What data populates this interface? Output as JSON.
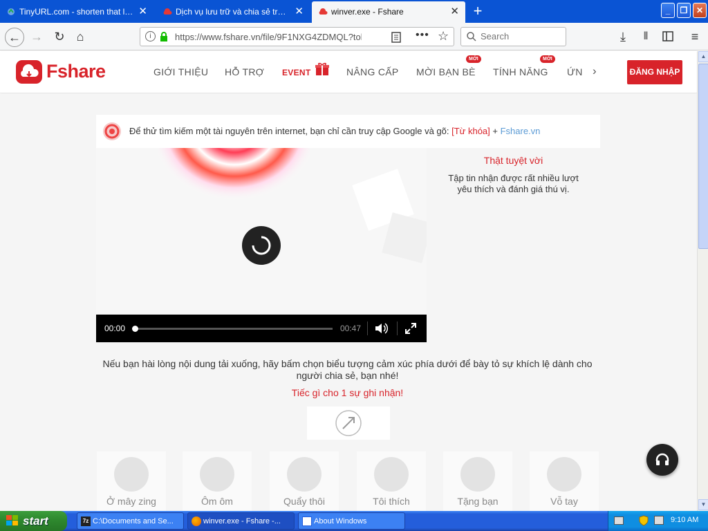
{
  "browser": {
    "tabs": [
      {
        "label": "TinyURL.com - shorten that long U",
        "active": false
      },
      {
        "label": "Dịch vụ lưu trữ và chia sẻ trực tuy",
        "active": false
      },
      {
        "label": "winver.exe - Fshare",
        "active": true
      }
    ],
    "url": "https://www.fshare.vn/file/9F1NXG4ZDMQL?tok",
    "search_placeholder": "Search"
  },
  "site": {
    "logo": "Fshare",
    "menu": [
      "GIỚI THIỆU",
      "HỖ TRỢ",
      "EVENT",
      "NÂNG CẤP",
      "MỜI BẠN BÈ",
      "TÍNH NĂNG",
      "ỨN"
    ],
    "new_badge": "MỚI",
    "login": "ĐĂNG NHẬP"
  },
  "content": {
    "tip_main": "Để thử tìm kiếm một tài nguyên trên internet, bạn chỉ cần truy cập Google và gõ: ",
    "tip_keyword": "[Từ khóa]",
    "tip_plus": " + ",
    "tip_site": "Fshare.vn",
    "video_current": "00:00",
    "video_duration": "00:47",
    "side_title": "Thật tuyệt vời",
    "side_desc": "Tập tin nhận được rất nhiều lượt yêu thích và đánh giá thú vị.",
    "message": "Nếu bạn hài lòng nội dung tải xuống, hãy bấm chọn biểu tượng cảm xúc phía dưới để bày tỏ sự khích lệ dành cho người chia sẻ, bạn nhé!",
    "message_accent": "Tiếc gì cho 1 sự ghi nhận!",
    "reactions": [
      "Ở mây zing",
      "Ôm ôm",
      "Quẩy thôi",
      "Tôi thích",
      "Tặng bạn",
      "Vỗ tay"
    ]
  },
  "taskbar": {
    "start": "start",
    "tasks": [
      "C:\\Documents and Se...",
      "winver.exe - Fshare -...",
      "About Windows"
    ],
    "clock": "9:10 AM"
  },
  "colors": {
    "brand": "#d8232a",
    "xp_blue": "#245edb",
    "link": "#5b9bd5"
  }
}
